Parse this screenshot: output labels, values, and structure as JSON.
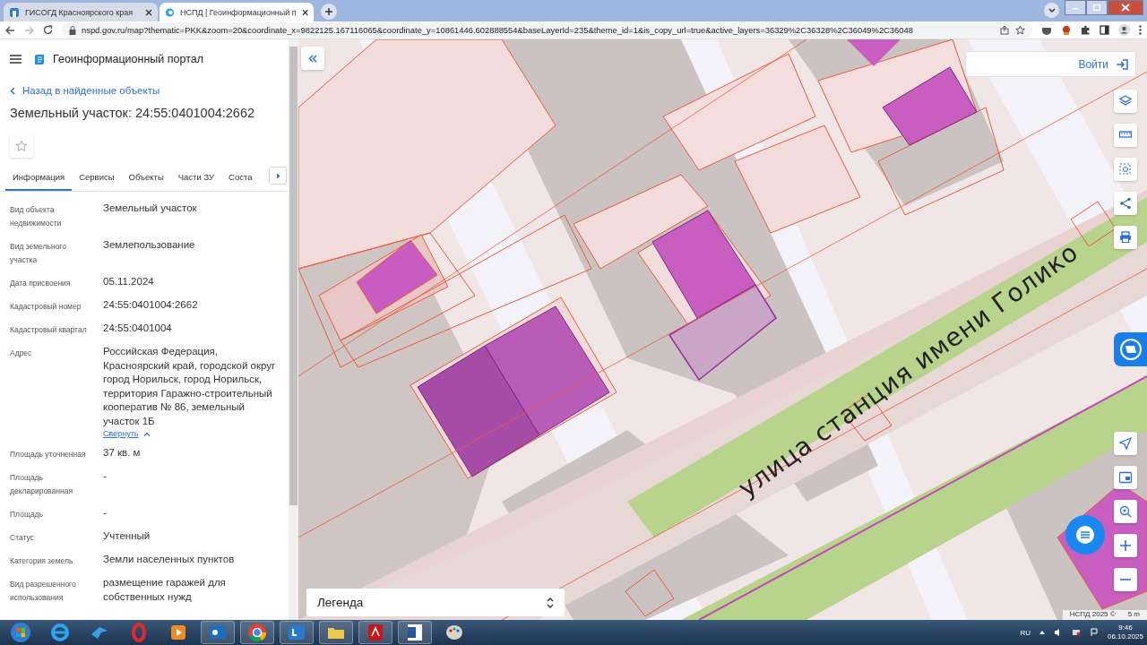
{
  "browser": {
    "tabs": [
      {
        "title": "ГИСОГД Красноярского края",
        "selected": false
      },
      {
        "title": "НСПД | Геоинформационный п",
        "selected": true
      }
    ],
    "url": "nspd.gov.ru/map?thematic=PKK&zoom=20&coordinate_x=9822125.167116065&coordinate_y=10861446.602888554&baseLayerId=235&theme_id=1&is_copy_url=true&active_layers=36329%2C36328%2C36049%2C36048"
  },
  "header": {
    "title": "Геоинформационный портал"
  },
  "back_link": "Назад в найденные объекты",
  "object_title": "Земельный участок: 24:55:0401004:2662",
  "tabs": [
    {
      "label": "Информация",
      "selected": true
    },
    {
      "label": "Сервисы",
      "selected": false
    },
    {
      "label": "Объекты",
      "selected": false
    },
    {
      "label": "Части ЗУ",
      "selected": false
    },
    {
      "label": "Соста",
      "selected": false
    }
  ],
  "fields": [
    {
      "label": "Вид объекта недвижимости",
      "value": "Земельный участок"
    },
    {
      "label": "Вид земельного участка",
      "value": "Землепользование"
    },
    {
      "label": "Дата присвоения",
      "value": "05.11.2024"
    },
    {
      "label": "Кадастровый номер",
      "value": "24:55:0401004:2662"
    },
    {
      "label": "Кадастровый квартал",
      "value": "24:55:0401004"
    },
    {
      "label": "Адрес",
      "value": "Российская Федерация, Красноярский край, городской округ город Норильск, город Норильск, территория Гаражно-строительный кооператив № 86, земельный участок 1Б",
      "link": "Свернуть"
    },
    {
      "label": "Площадь уточненная",
      "value": "37 кв. м"
    },
    {
      "label": "Площадь декларированная",
      "value": "-"
    },
    {
      "label": "Площадь",
      "value": "-"
    },
    {
      "label": "Статус",
      "value": "Учтенный"
    },
    {
      "label": "Категория земель",
      "value": "Земли населенных пунктов"
    },
    {
      "label": "Вид разрешенного использования",
      "value": "размещение гаражей для собственных нужд"
    }
  ],
  "map": {
    "login": "Войти",
    "street": "улица станция имени Голико",
    "legend": "Легенда",
    "attribution": "НСПД 2025 ©",
    "scale": "5 m"
  },
  "taskbar": {
    "language": "RU",
    "time": "9:46",
    "date": "06.10.2025"
  }
}
